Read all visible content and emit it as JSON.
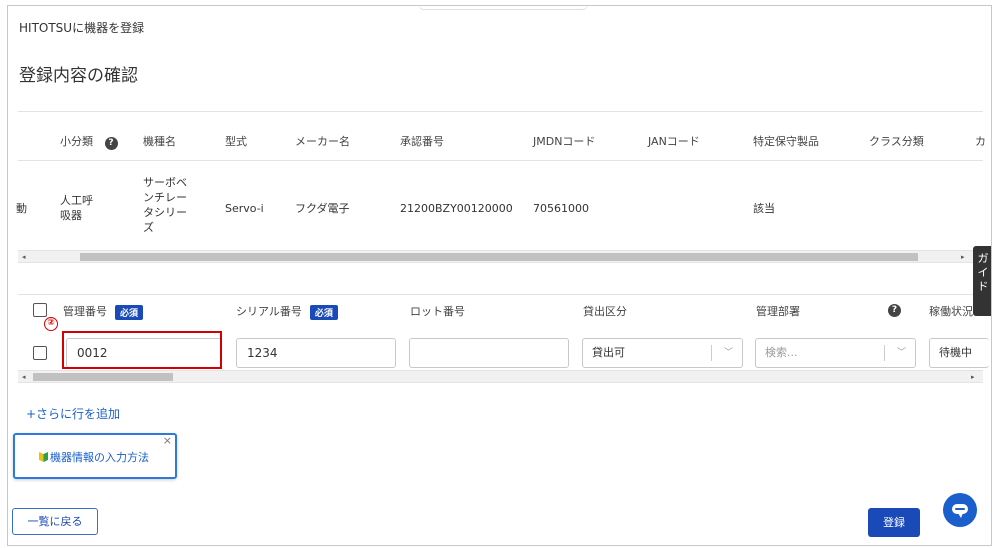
{
  "breadcrumb": "HITOTSUに機器を登録",
  "page_title": "登録内容の確認",
  "top_table": {
    "headers": [
      "小分類",
      "機種名",
      "型式",
      "メーカー名",
      "承認番号",
      "JMDNコード",
      "JANコード",
      "特定保守製品",
      "クラス分類",
      "カ"
    ],
    "row": {
      "lead": "動",
      "subcategory": "人工呼吸器",
      "model_name": "サーボベンチレータシリーズ",
      "model_type": "Servo-i",
      "maker": "フクダ電子",
      "approval_no": "21200BZY00120000",
      "jmdn": "70561000",
      "jan": "",
      "special": "該当",
      "class": ""
    }
  },
  "scroll": {
    "left": "◂",
    "right": "▸"
  },
  "bottom_table": {
    "headers": {
      "mgmt_no": "管理番号",
      "serial_no": "シリアル番号",
      "lot_no": "ロット番号",
      "lend": "貸出区分",
      "dept": "管理部署",
      "status": "稼働状況"
    },
    "required": "必須",
    "row": {
      "mgmt_no": "0012",
      "serial_no": "1234",
      "lot_no": "",
      "lend": "貸出可",
      "dept_placeholder": "検索...",
      "status": "待機中"
    }
  },
  "help_glyph": "?",
  "chevron": "﹀",
  "annotation_marker": "②",
  "add_row": "+さらに行を追加",
  "guide_popup": {
    "link": "機器情報の入力方法",
    "close": "×"
  },
  "side_tab": "ガイド",
  "buttons": {
    "back": "一覧に戻る",
    "register": "登録"
  },
  "colors": {
    "accent": "#1a49b8",
    "link": "#1a5fcc",
    "annotation": "#d40000"
  }
}
